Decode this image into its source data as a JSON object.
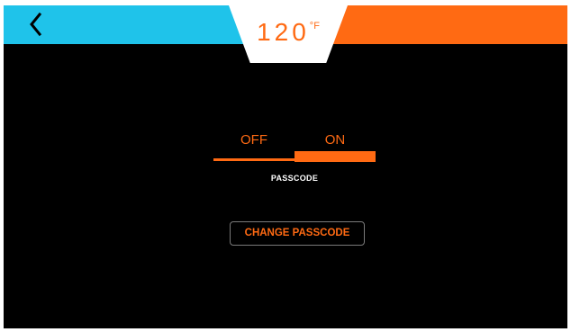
{
  "header": {
    "temperature_value": "120",
    "temperature_unit": "°F",
    "back_icon": "chevron-left-icon",
    "left_color": "#1fc3ea",
    "right_color": "#ff6a13"
  },
  "passcode_toggle": {
    "off_label": "OFF",
    "on_label": "ON",
    "selected": "ON",
    "label": "PASSCODE"
  },
  "change_passcode_button": {
    "label": "CHANGE PASSCODE"
  },
  "colors": {
    "accent": "#ff6a13",
    "background": "#000000",
    "text": "#ffffff"
  }
}
